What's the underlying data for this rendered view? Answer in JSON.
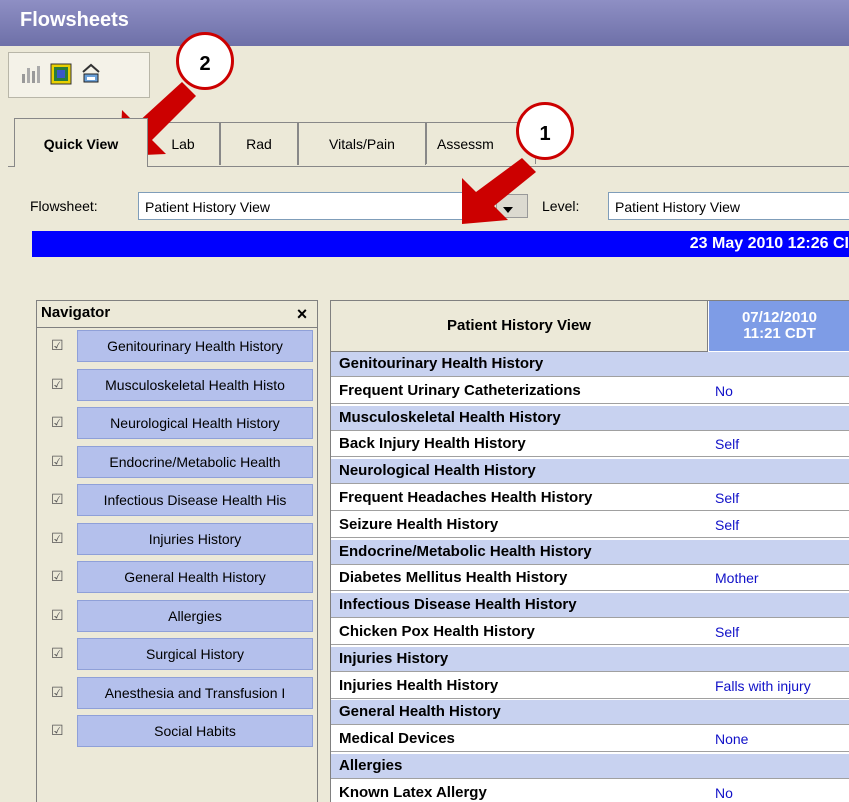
{
  "window": {
    "title": "Flowsheets"
  },
  "toolbar": {
    "icons": [
      "bar-chart-icon",
      "grid-view-icon",
      "printer-icon"
    ]
  },
  "tabs": [
    {
      "label": "Quick View",
      "active": true
    },
    {
      "label": "Lab"
    },
    {
      "label": "Rad"
    },
    {
      "label": "Vitals/Pain"
    },
    {
      "label": "Assessm"
    }
  ],
  "filters": {
    "flowsheet_label": "Flowsheet:",
    "flowsheet_value": "Patient History View",
    "level_label": "Level:",
    "level_value": "Patient History View"
  },
  "datebar": {
    "text": "23 May 2010 12:26 CI"
  },
  "navigator": {
    "title": "Navigator",
    "close_label": "×",
    "items": [
      "Genitourinary Health History",
      "Musculoskeletal Health Histo",
      "Neurological Health History",
      "Endocrine/Metabolic Health",
      "Infectious Disease Health His",
      "Injuries History",
      "General Health History",
      "Allergies",
      "Surgical History",
      "Anesthesia and Transfusion I",
      "Social Habits"
    ]
  },
  "grid": {
    "header": "Patient History View",
    "date_line1": "07/12/2010",
    "date_line2": "11:21 CDT",
    "rows": [
      {
        "label": "Genitourinary Health History",
        "value": "",
        "section": true
      },
      {
        "label": "Frequent Urinary Catheterizations",
        "value": "No",
        "section": false
      },
      {
        "label": "Musculoskeletal Health History",
        "value": "",
        "section": true
      },
      {
        "label": "Back Injury Health History",
        "value": "Self",
        "section": false
      },
      {
        "label": "Neurological Health History",
        "value": "",
        "section": true
      },
      {
        "label": "Frequent Headaches Health History",
        "value": "Self",
        "section": false
      },
      {
        "label": "Seizure Health History",
        "value": "Self",
        "section": false
      },
      {
        "label": "Endocrine/Metabolic Health History",
        "value": "",
        "section": true
      },
      {
        "label": "Diabetes Mellitus Health History",
        "value": "Mother",
        "section": false
      },
      {
        "label": "Infectious Disease Health History",
        "value": "",
        "section": true
      },
      {
        "label": "Chicken Pox Health History",
        "value": "Self",
        "section": false
      },
      {
        "label": "Injuries History",
        "value": "",
        "section": true
      },
      {
        "label": "Injuries Health History",
        "value": "Falls with injury",
        "section": false
      },
      {
        "label": "General Health History",
        "value": "",
        "section": true
      },
      {
        "label": "Medical Devices",
        "value": "None",
        "section": false
      },
      {
        "label": "Allergies",
        "value": "",
        "section": true
      },
      {
        "label": "Known Latex Allergy",
        "value": "No",
        "section": false
      }
    ]
  },
  "callouts": [
    "1",
    "2"
  ],
  "colors": {
    "accent_red": "#cc0000",
    "date_blue": "#0000ff",
    "section_fill": "#c8d2f0"
  }
}
